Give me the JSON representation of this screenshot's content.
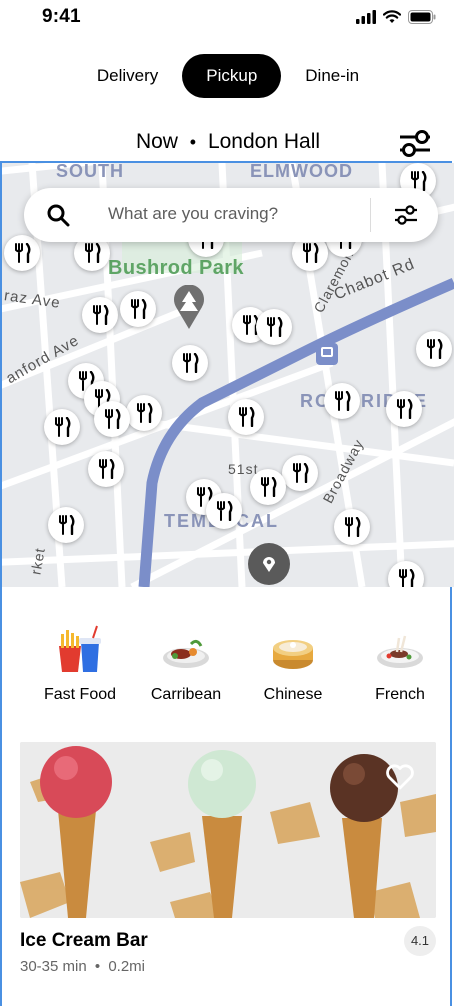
{
  "status_bar": {
    "time": "9:41"
  },
  "modes": [
    {
      "label": "Delivery",
      "active": false
    },
    {
      "label": "Pickup",
      "active": true
    },
    {
      "label": "Dine-in",
      "active": false
    }
  ],
  "location": {
    "time": "Now",
    "separator": "•",
    "place": "London Hall"
  },
  "search": {
    "placeholder": "What are you craving?"
  },
  "map": {
    "labels": [
      "SOUTH",
      "ELMWOOD",
      "Bushrod Park",
      "Chabot Rd",
      "raz Ave",
      "anford Ave",
      "Claremont",
      "ROCKRIDGE",
      "Broadway",
      "51st",
      "TEMESCAL",
      "rket"
    ],
    "pin_icon": "fork-knife-icon"
  },
  "categories": [
    {
      "label": "Fast Food",
      "icon": "fast-food-icon"
    },
    {
      "label": "Carribean",
      "icon": "caribbean-dish-icon"
    },
    {
      "label": "Chinese",
      "icon": "dim-sum-icon"
    },
    {
      "label": "French",
      "icon": "french-dish-icon"
    }
  ],
  "restaurant": {
    "name": "Ice Cream Bar",
    "time_range": "30-35 min",
    "dot": "•",
    "distance": "0.2mi",
    "rating": "4.1"
  },
  "colors": {
    "accent": "#000000",
    "frame": "#4a90e2",
    "route": "#7b8ec9"
  }
}
